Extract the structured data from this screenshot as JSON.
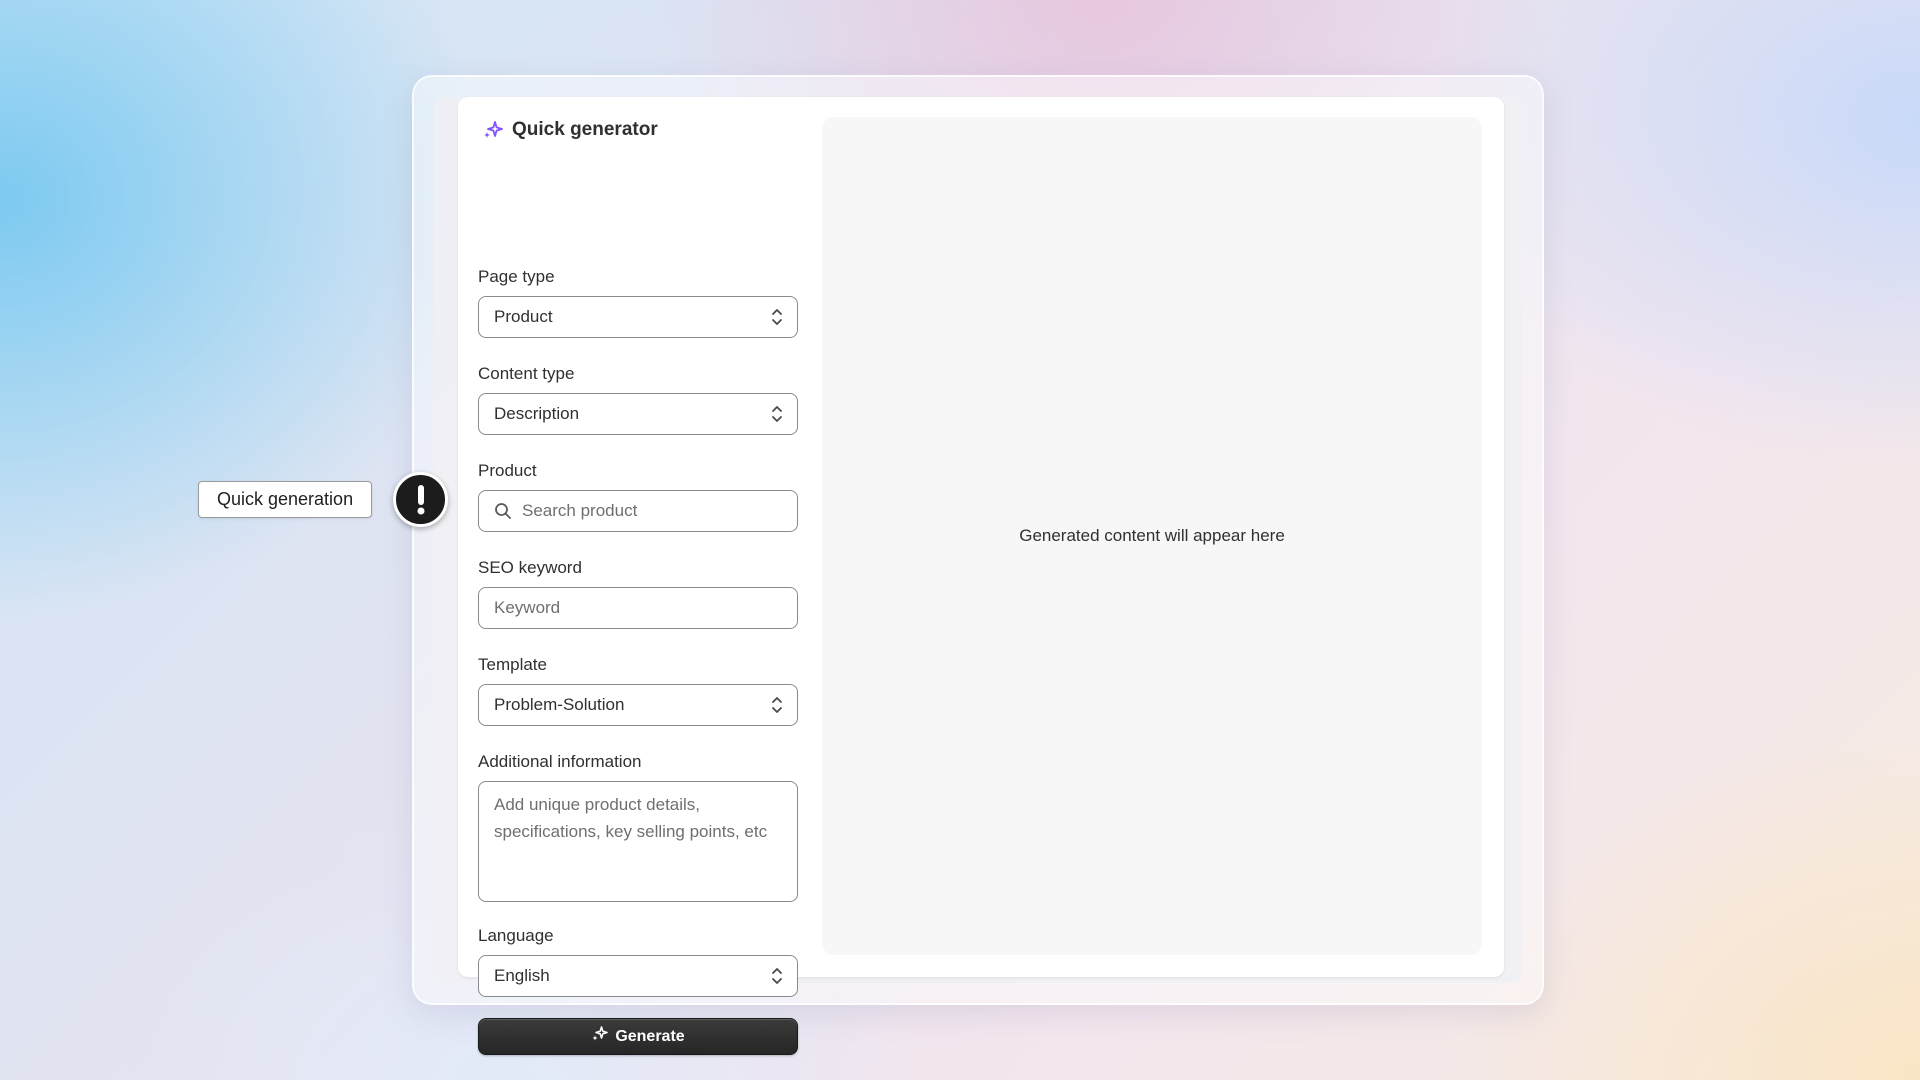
{
  "app": {
    "title": "Quick generator"
  },
  "form": {
    "page_type": {
      "label": "Page type",
      "value": "Product"
    },
    "content_type": {
      "label": "Content type",
      "value": "Description"
    },
    "product": {
      "label": "Product",
      "placeholder": "Search product"
    },
    "seo_keyword": {
      "label": "SEO keyword",
      "placeholder": "Keyword"
    },
    "template": {
      "label": "Template",
      "value": "Problem-Solution"
    },
    "additional_info": {
      "label": "Additional information",
      "placeholder": "Add unique product details, specifications, key selling points, etc"
    },
    "language": {
      "label": "Language",
      "value": "English"
    },
    "generate_label": "Generate"
  },
  "preview": {
    "empty_text": "Generated content will appear here"
  },
  "annotation": {
    "label": "Quick generation",
    "icon": "exclamation-icon"
  },
  "colors": {
    "accent_purple": "#8051ff",
    "button_dark": "#303030"
  },
  "icons": {
    "header": "sparkle-icon",
    "select": "select-chevrons-icon",
    "search": "search-icon",
    "generate": "sparkle-icon"
  }
}
